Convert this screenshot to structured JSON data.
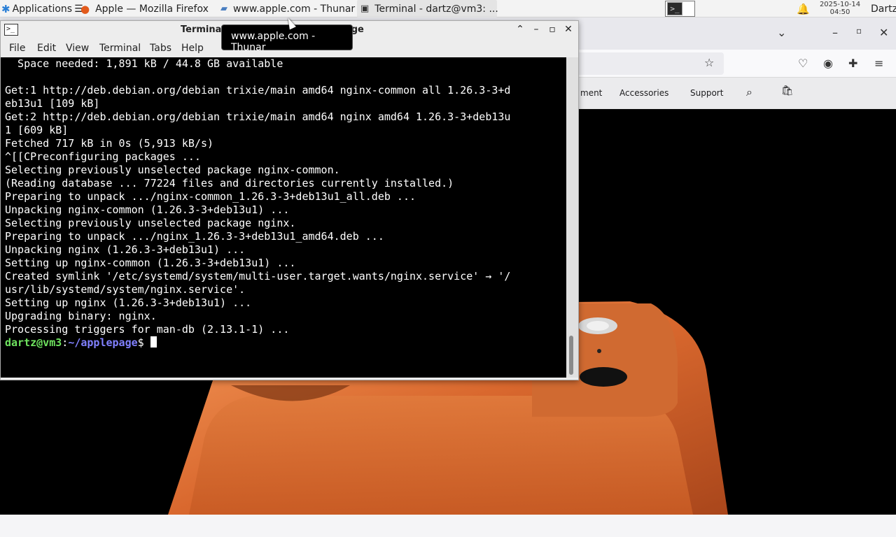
{
  "panel": {
    "apps_label": "Applications",
    "apps_glyph": "☰",
    "tasks": [
      {
        "label": "Apple — Mozilla Firefox",
        "icon": "firefox-icon",
        "active": false
      },
      {
        "label": "www.apple.com - Thunar",
        "icon": "folder-icon",
        "active": false
      },
      {
        "label": "Terminal - dartz@vm3: ...",
        "icon": "terminal-icon",
        "active": true
      }
    ],
    "date": "2025-10-14",
    "time": "04:50",
    "user": "Dartz",
    "ws_glyph": ">_"
  },
  "firefox": {
    "nav_items": [
      "ment",
      "Accessories",
      "Support"
    ],
    "bg_color": "#000000",
    "hero_accent": "#e0733a"
  },
  "terminal": {
    "title": "Terminal - dartz@vm3: ~/applepage",
    "menu": [
      "File",
      "Edit",
      "View",
      "Terminal",
      "Tabs",
      "Help"
    ],
    "lines": [
      "  Space needed: 1,891 kB / 44.8 GB available",
      "",
      "Get:1 http://deb.debian.org/debian trixie/main amd64 nginx-common all 1.26.3-3+d",
      "eb13u1 [109 kB]",
      "Get:2 http://deb.debian.org/debian trixie/main amd64 nginx amd64 1.26.3-3+deb13u",
      "1 [609 kB]",
      "Fetched 717 kB in 0s (5,913 kB/s)",
      "^[[CPreconfiguring packages ...",
      "Selecting previously unselected package nginx-common.",
      "(Reading database ... 77224 files and directories currently installed.)",
      "Preparing to unpack .../nginx-common_1.26.3-3+deb13u1_all.deb ...",
      "Unpacking nginx-common (1.26.3-3+deb13u1) ...",
      "Selecting previously unselected package nginx.",
      "Preparing to unpack .../nginx_1.26.3-3+deb13u1_amd64.deb ...",
      "Unpacking nginx (1.26.3-3+deb13u1) ...",
      "Setting up nginx-common (1.26.3-3+deb13u1) ...",
      "Created symlink '/etc/systemd/system/multi-user.target.wants/nginx.service' → '/",
      "usr/lib/systemd/system/nginx.service'.",
      "Setting up nginx (1.26.3-3+deb13u1) ...",
      "Upgrading binary: nginx.",
      "Processing triggers for man-db (2.13.1-1) ..."
    ],
    "prompt_user": "dartz@vm3",
    "prompt_sep": ":",
    "prompt_path": "~/applepage",
    "prompt_end": "$ ",
    "glyphs": {
      "icon": ">_",
      "up": "⌃",
      "min": "–",
      "max": "▫",
      "close": "✕"
    }
  },
  "tooltip": {
    "text": "www.apple.com - Thunar"
  }
}
